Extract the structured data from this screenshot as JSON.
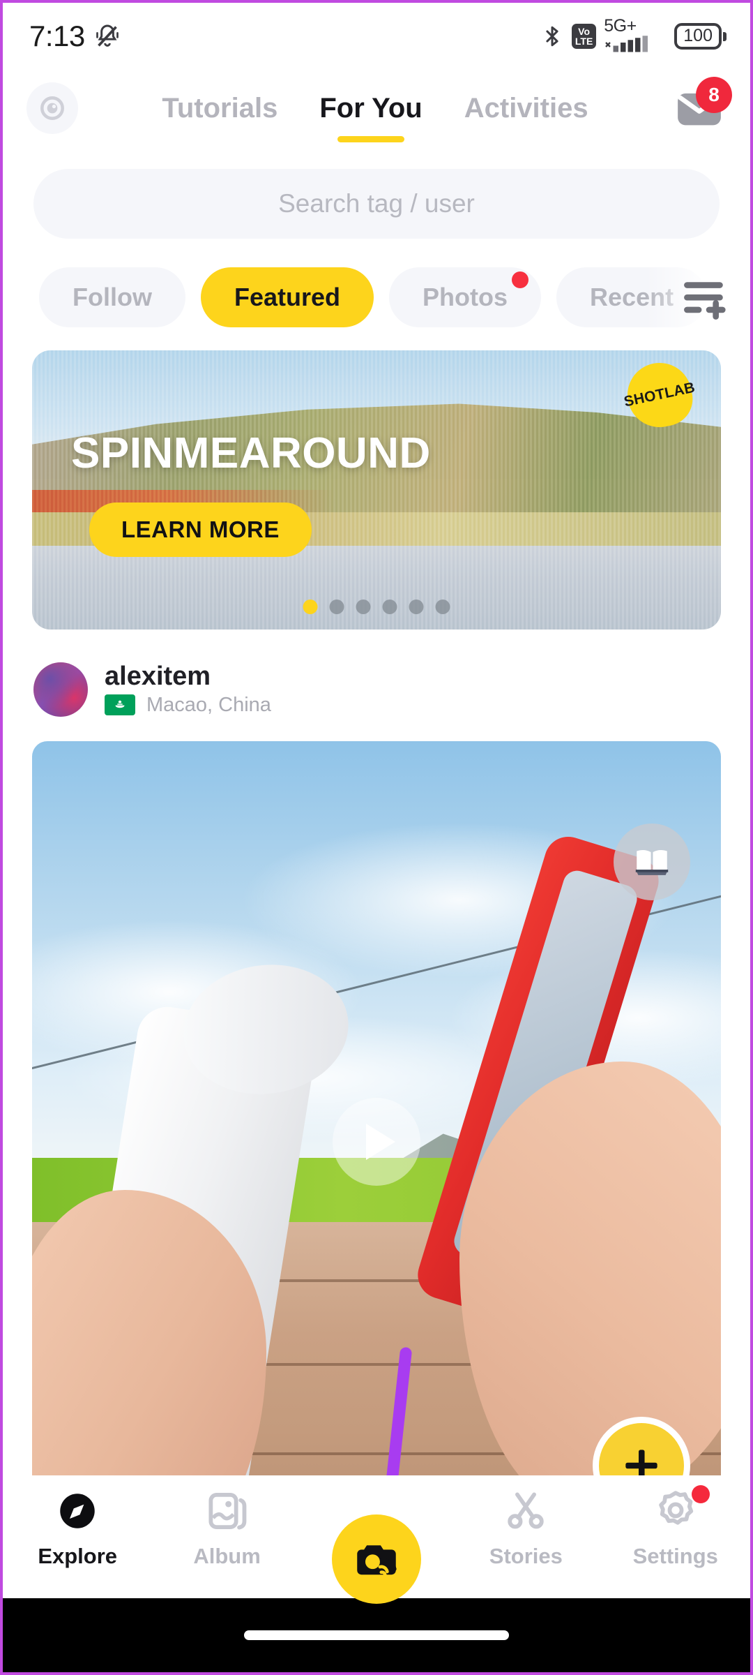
{
  "status_bar": {
    "time": "7:13",
    "mute_icon": "bell-muted-icon",
    "bluetooth_icon": "bluetooth-icon",
    "volte_line1": "Vo",
    "volte_line2": "LTE",
    "network_label": "5G+",
    "signal_icon": "signal-bars-icon",
    "battery_level": "100"
  },
  "header": {
    "lens_icon": "camera-lens-icon",
    "tabs": [
      {
        "label": "Tutorials",
        "active": false
      },
      {
        "label": "For You",
        "active": true
      },
      {
        "label": "Activities",
        "active": false
      }
    ],
    "mail_icon": "inbox-icon",
    "mail_badge": "8"
  },
  "search": {
    "placeholder": "Search tag / user",
    "value": ""
  },
  "chips": {
    "items": [
      {
        "label": "Follow",
        "active": false,
        "dot": false
      },
      {
        "label": "Featured",
        "active": true,
        "dot": false
      },
      {
        "label": "Photos",
        "active": false,
        "dot": true
      },
      {
        "label": "Recent",
        "active": false,
        "dot": false
      }
    ],
    "filter_icon": "filter-add-icon"
  },
  "banner": {
    "title": "SPINMEAROUND",
    "cta_label": "LEARN MORE",
    "badge_label": "SHOTLAB",
    "dots_total": 6,
    "dots_active_index": 0
  },
  "post": {
    "username": "alexitem",
    "location": "Macao, China",
    "flag_icon": "macao-flag-icon",
    "book_icon": "open-book-icon",
    "play_icon": "play-icon",
    "add_icon": "plus-icon"
  },
  "bottom_nav": {
    "items": [
      {
        "label": "Explore",
        "icon": "compass-icon",
        "active": true,
        "dot": false
      },
      {
        "label": "Album",
        "icon": "album-icon",
        "active": false,
        "dot": false
      },
      {
        "label": "Stories",
        "icon": "scissors-icon",
        "active": false,
        "dot": false
      },
      {
        "label": "Settings",
        "icon": "gear-icon",
        "active": false,
        "dot": true
      }
    ],
    "center_button_icon": "camera-wifi-icon"
  },
  "annotation": {
    "arrow_icon": "purple-arrow-icon",
    "arrow_color": "#a83cf0"
  },
  "colors": {
    "accent_yellow": "#fdd41c",
    "badge_red": "#f0283c",
    "chip_bg": "#f5f6fa",
    "text_dark": "#17171c",
    "text_muted": "#b4b5bd"
  }
}
